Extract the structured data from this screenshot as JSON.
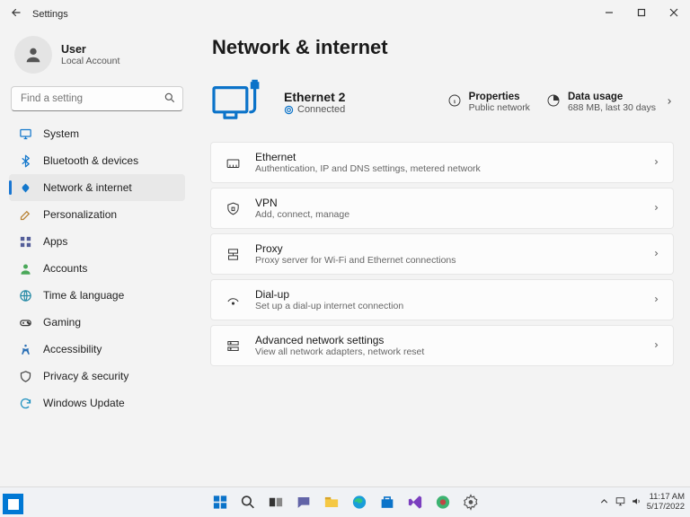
{
  "window": {
    "title": "Settings"
  },
  "user": {
    "name": "User",
    "account_type": "Local Account"
  },
  "search": {
    "placeholder": "Find a setting"
  },
  "sidebar": {
    "items": [
      {
        "label": "System",
        "icon": "system",
        "color": "#1478cc"
      },
      {
        "label": "Bluetooth & devices",
        "icon": "bluetooth",
        "color": "#1478cc"
      },
      {
        "label": "Network & internet",
        "icon": "wifi",
        "color": "#1478cc",
        "selected": true
      },
      {
        "label": "Personalization",
        "icon": "brush",
        "color": "#b88335"
      },
      {
        "label": "Apps",
        "icon": "apps",
        "color": "#545e99"
      },
      {
        "label": "Accounts",
        "icon": "person",
        "color": "#4aa859"
      },
      {
        "label": "Time & language",
        "icon": "globe",
        "color": "#2a8ca7"
      },
      {
        "label": "Gaming",
        "icon": "gaming",
        "color": "#3a3a3a"
      },
      {
        "label": "Accessibility",
        "icon": "accessibility",
        "color": "#2a6fb5"
      },
      {
        "label": "Privacy & security",
        "icon": "shield",
        "color": "#4a4a4a"
      },
      {
        "label": "Windows Update",
        "icon": "update",
        "color": "#1b8fbf"
      }
    ]
  },
  "page": {
    "title": "Network & internet",
    "status": {
      "connection_name": "Ethernet 2",
      "connection_state": "Connected",
      "properties": {
        "label": "Properties",
        "sub": "Public network"
      },
      "data_usage": {
        "label": "Data usage",
        "sub": "688 MB, last 30 days"
      }
    },
    "rows": [
      {
        "icon": "ethernet",
        "title": "Ethernet",
        "sub": "Authentication, IP and DNS settings, metered network"
      },
      {
        "icon": "vpn",
        "title": "VPN",
        "sub": "Add, connect, manage"
      },
      {
        "icon": "proxy",
        "title": "Proxy",
        "sub": "Proxy server for Wi-Fi and Ethernet connections"
      },
      {
        "icon": "dialup",
        "title": "Dial-up",
        "sub": "Set up a dial-up internet connection"
      },
      {
        "icon": "advanced",
        "title": "Advanced network settings",
        "sub": "View all network adapters, network reset"
      }
    ]
  },
  "taskbar": {
    "time": "11:17 AM",
    "date": "5/17/2022"
  }
}
